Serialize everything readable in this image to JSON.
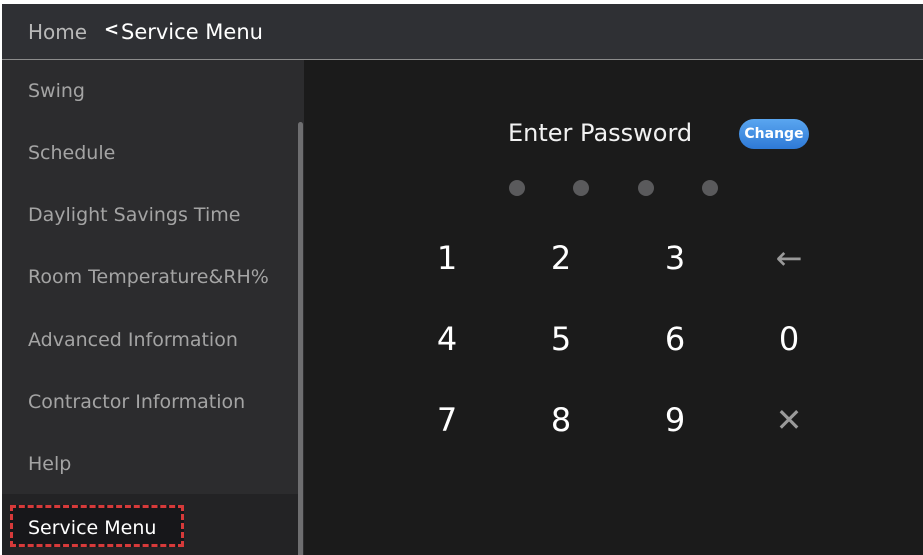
{
  "header": {
    "home_label": "Home",
    "back_icon": "chevron-left-icon",
    "title": "Service Menu"
  },
  "sidebar": {
    "items": [
      {
        "label": "Swing"
      },
      {
        "label": "Schedule"
      },
      {
        "label": "Daylight Savings Time"
      },
      {
        "label": "Room Temperature&RH%"
      },
      {
        "label": "Advanced Information"
      },
      {
        "label": "Contractor Information"
      },
      {
        "label": "Help"
      },
      {
        "label": "Service Menu",
        "selected": true
      }
    ]
  },
  "password": {
    "title": "Enter Password",
    "change_label": "Change",
    "digits_entered": 0,
    "digits_total": 4
  },
  "keypad": {
    "keys": [
      {
        "label": "1"
      },
      {
        "label": "2"
      },
      {
        "label": "3"
      },
      {
        "label": "←",
        "icon": "backspace-arrow-icon"
      },
      {
        "label": "4"
      },
      {
        "label": "5"
      },
      {
        "label": "6"
      },
      {
        "label": "0"
      },
      {
        "label": "7"
      },
      {
        "label": "8"
      },
      {
        "label": "9"
      },
      {
        "label": "✕",
        "icon": "close-icon"
      }
    ]
  },
  "colors": {
    "background": "#1b1b1b",
    "header": "#2f3034",
    "sidebar": "#2c2c2e",
    "accent_button": "#3a8ae3",
    "selection_outline": "#d63a3a"
  }
}
